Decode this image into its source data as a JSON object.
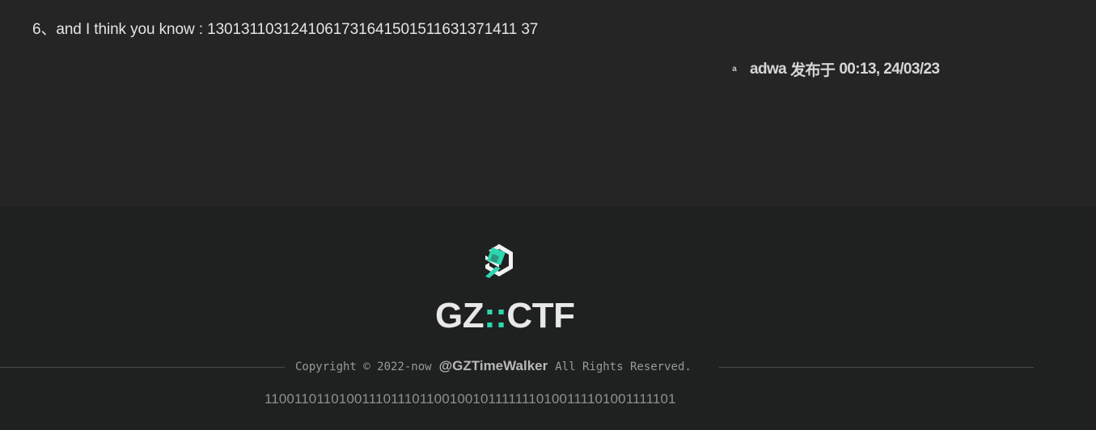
{
  "post": {
    "text": "6、and I think you know : 1301311031241061731641501511631371411 37",
    "avatar_initial": "a",
    "author": "adwa",
    "published_label": "发布于",
    "timestamp": "00:13, 24/03/23"
  },
  "footer": {
    "brand_left": "GZ",
    "brand_sep": "::",
    "brand_right": "CTF",
    "copyright_prefix": "Copyright © 2022-now",
    "copyright_handle": "@GZTimeWalker",
    "copyright_suffix": "All Rights Reserved.",
    "binary_string": "11001101101001110111011001001011111110100111101001111101"
  },
  "colors": {
    "accent": "#2ed6b0",
    "content_bg": "#252525",
    "footer_bg": "#1f2020"
  },
  "icons": {
    "logo": "gzctf-logo-icon"
  }
}
